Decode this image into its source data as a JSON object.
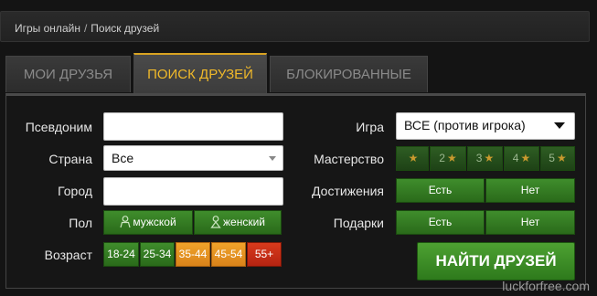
{
  "breadcrumb": {
    "item1": "Игры онлайн",
    "separator": "/",
    "item2": "Поиск друзей"
  },
  "tabs": [
    {
      "label": "МОИ ДРУЗЬЯ",
      "active": false
    },
    {
      "label": "ПОИСК ДРУЗЕЙ",
      "active": true
    },
    {
      "label": "БЛОКИРОВАННЫЕ",
      "active": false
    }
  ],
  "form": {
    "nickname_label": "Псевдоним",
    "nickname_value": "",
    "country_label": "Страна",
    "country_value": "Все",
    "city_label": "Город",
    "city_value": "",
    "gender_label": "Пол",
    "gender_male": "мужской",
    "gender_female": "женский",
    "age_label": "Возраст",
    "ages": [
      "18-24",
      "25-34",
      "35-44",
      "45-54",
      "55+"
    ],
    "game_label": "Игра",
    "game_value": "ВСЕ (против игрока)",
    "mastery_label": "Мастерство",
    "mastery_levels": [
      "",
      "2",
      "3",
      "4",
      "5"
    ],
    "achievements_label": "Достижения",
    "gifts_label": "Подарки",
    "yes_label": "Есть",
    "no_label": "Нет",
    "find_button": "НАЙТИ ДРУЗЕЙ"
  },
  "colors": {
    "accent": "#f0b92a",
    "green": "#3f8d2c",
    "orange": "#f0a32a",
    "red": "#d83a1c"
  },
  "watermark": "luckforfree.com"
}
